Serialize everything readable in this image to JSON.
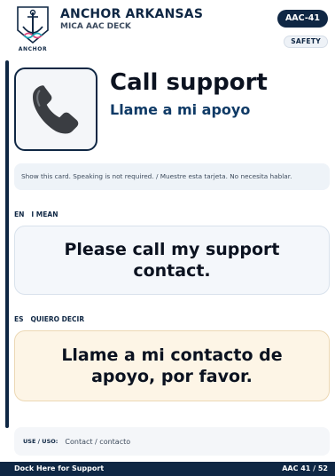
{
  "header": {
    "brand_title": "ANCHOR ARKANSAS",
    "brand_subtitle": "MICA AAC DECK",
    "logo_text": "ANCHOR",
    "card_code": "AAC-41",
    "category_tag": "SAFETY"
  },
  "card": {
    "icon": "phone-icon",
    "title": "Call support",
    "subtitle": "Llame a mi apoyo",
    "instruction": "Show this card. Speaking is not required. / Muestre esta tarjeta. No necesita hablar."
  },
  "english": {
    "code": "EN",
    "label": "I MEAN",
    "phrase": "Please call my support contact."
  },
  "spanish": {
    "code": "ES",
    "label": "QUIERO DECIR",
    "phrase": "Llame a mi contacto de apoyo, por favor."
  },
  "usage": {
    "label": "USE / USO:",
    "value": "Contact / contacto"
  },
  "footer": {
    "left": "Dock Here for Support",
    "right": "AAC 41 / 52"
  },
  "colors": {
    "navy": "#0f2744",
    "accent_blue": "#0f3a66",
    "spanish_bg": "#fdf5e6",
    "english_bg": "#f4f7fb"
  }
}
